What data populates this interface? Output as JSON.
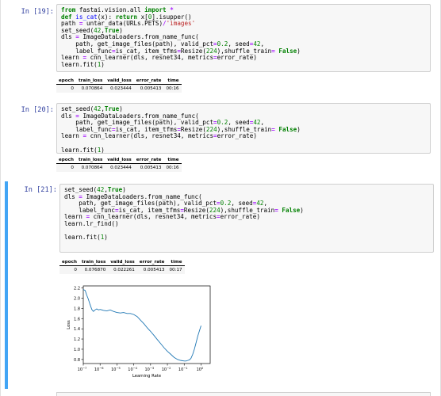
{
  "cells": [
    {
      "prompt": "In [19]:",
      "code": [
        [
          [
            "kw",
            "from"
          ],
          [
            "t",
            " fastai.vision.all "
          ],
          [
            "kw",
            "import"
          ],
          [
            "t",
            " "
          ],
          [
            "op",
            "*"
          ]
        ],
        [
          [
            "kw",
            "def"
          ],
          [
            "t",
            " "
          ],
          [
            "fn",
            "is_cat"
          ],
          [
            "t",
            "(x): "
          ],
          [
            "kw",
            "return"
          ],
          [
            "t",
            " x["
          ],
          [
            "num",
            "0"
          ],
          [
            "t",
            "].isupper()"
          ]
        ],
        [
          [
            "t",
            "path "
          ],
          [
            "op",
            "="
          ],
          [
            "t",
            " untar_data(URLs.PETS)"
          ],
          [
            "op",
            "/"
          ],
          [
            "str",
            "'images'"
          ]
        ],
        [
          [
            "t",
            "set_seed("
          ],
          [
            "num",
            "42"
          ],
          [
            "t",
            ","
          ],
          [
            "kw",
            "True"
          ],
          [
            "t",
            ")"
          ]
        ],
        [
          [
            "t",
            "dls "
          ],
          [
            "op",
            "="
          ],
          [
            "t",
            " ImageDataLoaders.from_name_func("
          ]
        ],
        [
          [
            "t",
            "    path, get_image_files(path), valid_pct"
          ],
          [
            "op",
            "="
          ],
          [
            "num",
            "0.2"
          ],
          [
            "t",
            ", seed"
          ],
          [
            "op",
            "="
          ],
          [
            "num",
            "42"
          ],
          [
            "t",
            ","
          ]
        ],
        [
          [
            "t",
            "    label_func"
          ],
          [
            "op",
            "="
          ],
          [
            "t",
            "is_cat, item_tfms"
          ],
          [
            "op",
            "="
          ],
          [
            "t",
            "Resize("
          ],
          [
            "num",
            "224"
          ],
          [
            "t",
            "),shuffle_train"
          ],
          [
            "op",
            "="
          ],
          [
            "t",
            " "
          ],
          [
            "kw",
            "False"
          ],
          [
            "t",
            ")"
          ]
        ],
        [
          [
            "t",
            "learn "
          ],
          [
            "op",
            "="
          ],
          [
            "t",
            " cnn_learner(dls, resnet34, metrics"
          ],
          [
            "op",
            "="
          ],
          [
            "t",
            "error_rate)"
          ]
        ],
        [
          [
            "t",
            "learn.fit("
          ],
          [
            "num",
            "1"
          ],
          [
            "t",
            ")"
          ]
        ]
      ],
      "table": {
        "headers": [
          "epoch",
          "train_loss",
          "valid_loss",
          "error_rate",
          "time"
        ],
        "rows": [
          [
            "0",
            "0.070864",
            "0.023444",
            "0.005413",
            "00:16"
          ]
        ]
      }
    },
    {
      "prompt": "In [20]:",
      "code": [
        [
          [
            "t",
            "set_seed("
          ],
          [
            "num",
            "42"
          ],
          [
            "t",
            ","
          ],
          [
            "kw",
            "True"
          ],
          [
            "t",
            ")"
          ]
        ],
        [
          [
            "t",
            "dls "
          ],
          [
            "op",
            "="
          ],
          [
            "t",
            " ImageDataLoaders.from_name_func("
          ]
        ],
        [
          [
            "t",
            "    path, get_image_files(path), valid_pct"
          ],
          [
            "op",
            "="
          ],
          [
            "num",
            "0.2"
          ],
          [
            "t",
            ", seed"
          ],
          [
            "op",
            "="
          ],
          [
            "num",
            "42"
          ],
          [
            "t",
            ","
          ]
        ],
        [
          [
            "t",
            "    label_func"
          ],
          [
            "op",
            "="
          ],
          [
            "t",
            "is_cat, item_tfms"
          ],
          [
            "op",
            "="
          ],
          [
            "t",
            "Resize("
          ],
          [
            "num",
            "224"
          ],
          [
            "t",
            "),shuffle_train"
          ],
          [
            "op",
            "="
          ],
          [
            "t",
            " "
          ],
          [
            "kw",
            "False"
          ],
          [
            "t",
            ")"
          ]
        ],
        [
          [
            "t",
            "learn "
          ],
          [
            "op",
            "="
          ],
          [
            "t",
            " cnn_learner(dls, resnet34, metrics"
          ],
          [
            "op",
            "="
          ],
          [
            "t",
            "error_rate)"
          ]
        ],
        [
          [
            "t",
            ""
          ]
        ],
        [
          [
            "t",
            "learn.fit("
          ],
          [
            "num",
            "1"
          ],
          [
            "t",
            ")"
          ]
        ]
      ],
      "table": {
        "headers": [
          "epoch",
          "train_loss",
          "valid_loss",
          "error_rate",
          "time"
        ],
        "rows": [
          [
            "0",
            "0.070864",
            "0.023444",
            "0.005413",
            "00:16"
          ]
        ]
      }
    },
    {
      "prompt": "In [21]:",
      "code": [
        [
          [
            "t",
            "set_seed("
          ],
          [
            "num",
            "42"
          ],
          [
            "t",
            ","
          ],
          [
            "kw",
            "True"
          ],
          [
            "t",
            ")"
          ]
        ],
        [
          [
            "t",
            "dls "
          ],
          [
            "op",
            "="
          ],
          [
            "t",
            " ImageDataLoaders.from_name_func("
          ]
        ],
        [
          [
            "t",
            "    path, get_image_files(path), valid_pct"
          ],
          [
            "op",
            "="
          ],
          [
            "num",
            "0.2"
          ],
          [
            "t",
            ", seed"
          ],
          [
            "op",
            "="
          ],
          [
            "num",
            "42"
          ],
          [
            "t",
            ","
          ]
        ],
        [
          [
            "t",
            "    label_func"
          ],
          [
            "op",
            "="
          ],
          [
            "t",
            "is_cat, item_tfms"
          ],
          [
            "op",
            "="
          ],
          [
            "t",
            "Resize("
          ],
          [
            "num",
            "224"
          ],
          [
            "t",
            "),shuffle_train"
          ],
          [
            "op",
            "="
          ],
          [
            "t",
            " "
          ],
          [
            "kw",
            "False"
          ],
          [
            "t",
            ")"
          ]
        ],
        [
          [
            "t",
            "learn "
          ],
          [
            "op",
            "="
          ],
          [
            "t",
            " cnn_learner(dls, resnet34, metrics"
          ],
          [
            "op",
            "="
          ],
          [
            "t",
            "error_rate)"
          ]
        ],
        [
          [
            "t",
            "learn.lr_find()"
          ]
        ],
        [
          [
            "t",
            ""
          ]
        ],
        [
          [
            "t",
            "learn.fit("
          ],
          [
            "num",
            "1"
          ],
          [
            "t",
            ")"
          ]
        ]
      ],
      "table": {
        "headers": [
          "epoch",
          "train_loss",
          "valid_loss",
          "error_rate",
          "time"
        ],
        "rows": [
          [
            "0",
            "0.076870",
            "0.022261",
            "0.005413",
            "00:17"
          ]
        ]
      }
    }
  ],
  "chart_data": {
    "type": "line",
    "xlabel": "Learning Rate",
    "ylabel": "Loss",
    "xscale": "log",
    "xlim": [
      1e-07,
      3.5
    ],
    "ylim": [
      0.72,
      2.24
    ],
    "xticks": [
      {
        "value": 1e-07,
        "base": "10",
        "exp": "−7"
      },
      {
        "value": 1e-06,
        "base": "10",
        "exp": "−6"
      },
      {
        "value": 1e-05,
        "base": "10",
        "exp": "−5"
      },
      {
        "value": 0.0001,
        "base": "10",
        "exp": "−4"
      },
      {
        "value": 0.001,
        "base": "10",
        "exp": "−3"
      },
      {
        "value": 0.01,
        "base": "10",
        "exp": "−2"
      },
      {
        "value": 0.1,
        "base": "10",
        "exp": "−1"
      },
      {
        "value": 1,
        "base": "10",
        "exp": "0"
      }
    ],
    "yticks": [
      "0.8",
      "1.0",
      "1.2",
      "1.4",
      "1.6",
      "1.8",
      "2.0",
      "2.2"
    ],
    "grid": false,
    "line_color": "#1f77b4",
    "series": [
      {
        "x": [
          1e-07,
          1.3e-07,
          1.6e-07,
          2e-07,
          2.5e-07,
          3.2e-07,
          4e-07,
          5e-07,
          6.3e-07,
          8e-07,
          1e-06,
          1.6e-06,
          2.5e-06,
          4e-06,
          6.3e-06,
          1e-05,
          1.6e-05,
          2.5e-05,
          4e-05,
          6.3e-05,
          0.0001,
          0.00016,
          0.00025,
          0.0004,
          0.00063,
          0.001,
          0.0016,
          0.0025,
          0.004,
          0.0063,
          0.01,
          0.016,
          0.025,
          0.04,
          0.063,
          0.1,
          0.13,
          0.16,
          0.2,
          0.25,
          0.32,
          0.4,
          0.5,
          0.63,
          0.8,
          1
        ],
        "y": [
          2.17,
          2.15,
          2.06,
          1.98,
          1.88,
          1.78,
          1.74,
          1.77,
          1.79,
          1.77,
          1.78,
          1.76,
          1.75,
          1.77,
          1.74,
          1.72,
          1.71,
          1.72,
          1.7,
          1.7,
          1.68,
          1.64,
          1.57,
          1.5,
          1.42,
          1.35,
          1.27,
          1.19,
          1.11,
          1.03,
          0.96,
          0.9,
          0.84,
          0.8,
          0.78,
          0.77,
          0.77,
          0.78,
          0.79,
          0.82,
          0.9,
          1.0,
          1.12,
          1.25,
          1.36,
          1.46
        ]
      }
    ]
  }
}
